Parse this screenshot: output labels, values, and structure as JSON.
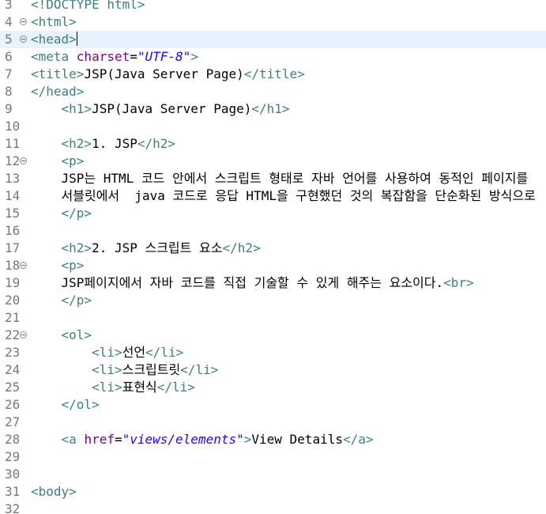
{
  "editor": {
    "current_line": 5,
    "lines": [
      {
        "num": "3",
        "fold": false,
        "indent": "",
        "tokens": [
          {
            "t": "tag",
            "v": "<!DOCTYPE html>"
          }
        ]
      },
      {
        "num": "4",
        "fold": true,
        "indent": "",
        "tokens": [
          {
            "t": "tag",
            "v": "<html>"
          }
        ]
      },
      {
        "num": "5",
        "fold": true,
        "indent": "",
        "tokens": [
          {
            "t": "tag",
            "v": "<head>"
          }
        ]
      },
      {
        "num": "6",
        "fold": false,
        "indent": "",
        "tokens": [
          {
            "t": "tag",
            "v": "<meta "
          },
          {
            "t": "attr",
            "v": "charset"
          },
          {
            "t": "txt",
            "v": "="
          },
          {
            "t": "str",
            "v": "\"UTF-8\""
          },
          {
            "t": "tag",
            "v": ">"
          }
        ]
      },
      {
        "num": "7",
        "fold": false,
        "indent": "",
        "tokens": [
          {
            "t": "tag",
            "v": "<title>"
          },
          {
            "t": "txt",
            "v": "JSP(Java Server Page)"
          },
          {
            "t": "tag",
            "v": "</title>"
          }
        ]
      },
      {
        "num": "8",
        "fold": false,
        "indent": "",
        "tokens": [
          {
            "t": "tag",
            "v": "</head>"
          }
        ]
      },
      {
        "num": "9",
        "fold": false,
        "indent": "    ",
        "tokens": [
          {
            "t": "tag",
            "v": "<h1>"
          },
          {
            "t": "txt",
            "v": "JSP(Java Server Page)"
          },
          {
            "t": "tag",
            "v": "</h1>"
          }
        ]
      },
      {
        "num": "10",
        "fold": false,
        "indent": "",
        "tokens": []
      },
      {
        "num": "11",
        "fold": false,
        "indent": "    ",
        "tokens": [
          {
            "t": "tag",
            "v": "<h2>"
          },
          {
            "t": "txt",
            "v": "1. JSP"
          },
          {
            "t": "tag",
            "v": "</h2>"
          }
        ]
      },
      {
        "num": "12",
        "fold": true,
        "indent": "    ",
        "tokens": [
          {
            "t": "tag",
            "v": "<p>"
          }
        ]
      },
      {
        "num": "13",
        "fold": false,
        "indent": "    ",
        "tokens": [
          {
            "t": "txt",
            "v": "JSP는 HTML 코드 안에서 스크립트 형태로 자바 언어를 사용하여 동적인 페이지를"
          }
        ]
      },
      {
        "num": "14",
        "fold": false,
        "indent": "    ",
        "tokens": [
          {
            "t": "txt",
            "v": "서블릿에서  java 코드로 응답 HTML을 구현했던 것의 복잡함을 단순화된 방식으로"
          }
        ]
      },
      {
        "num": "15",
        "fold": false,
        "indent": "    ",
        "tokens": [
          {
            "t": "tag",
            "v": "</p>"
          }
        ]
      },
      {
        "num": "16",
        "fold": false,
        "indent": "",
        "tokens": []
      },
      {
        "num": "17",
        "fold": false,
        "indent": "    ",
        "tokens": [
          {
            "t": "tag",
            "v": "<h2>"
          },
          {
            "t": "txt",
            "v": "2. JSP 스크립트 요소"
          },
          {
            "t": "tag",
            "v": "</h2>"
          }
        ]
      },
      {
        "num": "18",
        "fold": true,
        "indent": "    ",
        "tokens": [
          {
            "t": "tag",
            "v": "<p>"
          }
        ]
      },
      {
        "num": "19",
        "fold": false,
        "indent": "    ",
        "tokens": [
          {
            "t": "txt",
            "v": "JSP페이지에서 자바 코드를 직접 기술할 수 있게 해주는 요소이다."
          },
          {
            "t": "tag",
            "v": "<br>"
          }
        ]
      },
      {
        "num": "20",
        "fold": false,
        "indent": "    ",
        "tokens": [
          {
            "t": "tag",
            "v": "</p>"
          }
        ]
      },
      {
        "num": "21",
        "fold": false,
        "indent": "",
        "tokens": []
      },
      {
        "num": "22",
        "fold": true,
        "indent": "    ",
        "tokens": [
          {
            "t": "tag",
            "v": "<ol>"
          }
        ]
      },
      {
        "num": "23",
        "fold": false,
        "indent": "        ",
        "tokens": [
          {
            "t": "tag",
            "v": "<li>"
          },
          {
            "t": "txt",
            "v": "선언"
          },
          {
            "t": "tag",
            "v": "</li>"
          }
        ]
      },
      {
        "num": "24",
        "fold": false,
        "indent": "        ",
        "tokens": [
          {
            "t": "tag",
            "v": "<li>"
          },
          {
            "t": "txt",
            "v": "스크립트릿"
          },
          {
            "t": "tag",
            "v": "</li>"
          }
        ]
      },
      {
        "num": "25",
        "fold": false,
        "indent": "        ",
        "tokens": [
          {
            "t": "tag",
            "v": "<li>"
          },
          {
            "t": "txt",
            "v": "표현식"
          },
          {
            "t": "tag",
            "v": "</li>"
          }
        ]
      },
      {
        "num": "26",
        "fold": false,
        "indent": "    ",
        "tokens": [
          {
            "t": "tag",
            "v": "</ol>"
          }
        ]
      },
      {
        "num": "27",
        "fold": false,
        "indent": "",
        "tokens": []
      },
      {
        "num": "28",
        "fold": false,
        "indent": "    ",
        "tokens": [
          {
            "t": "tag",
            "v": "<a "
          },
          {
            "t": "attr",
            "v": "href"
          },
          {
            "t": "txt",
            "v": "="
          },
          {
            "t": "str",
            "v": "\"views/elements\""
          },
          {
            "t": "tag",
            "v": ">"
          },
          {
            "t": "txt",
            "v": "View Details"
          },
          {
            "t": "tag",
            "v": "</a>"
          }
        ]
      },
      {
        "num": "29",
        "fold": false,
        "indent": "",
        "tokens": []
      },
      {
        "num": "30",
        "fold": false,
        "indent": "",
        "tokens": []
      },
      {
        "num": "31",
        "fold": false,
        "indent": "",
        "tokens": [
          {
            "t": "tag",
            "v": "<body>"
          }
        ]
      },
      {
        "num": "32",
        "fold": false,
        "indent": "",
        "tokens": []
      }
    ]
  }
}
